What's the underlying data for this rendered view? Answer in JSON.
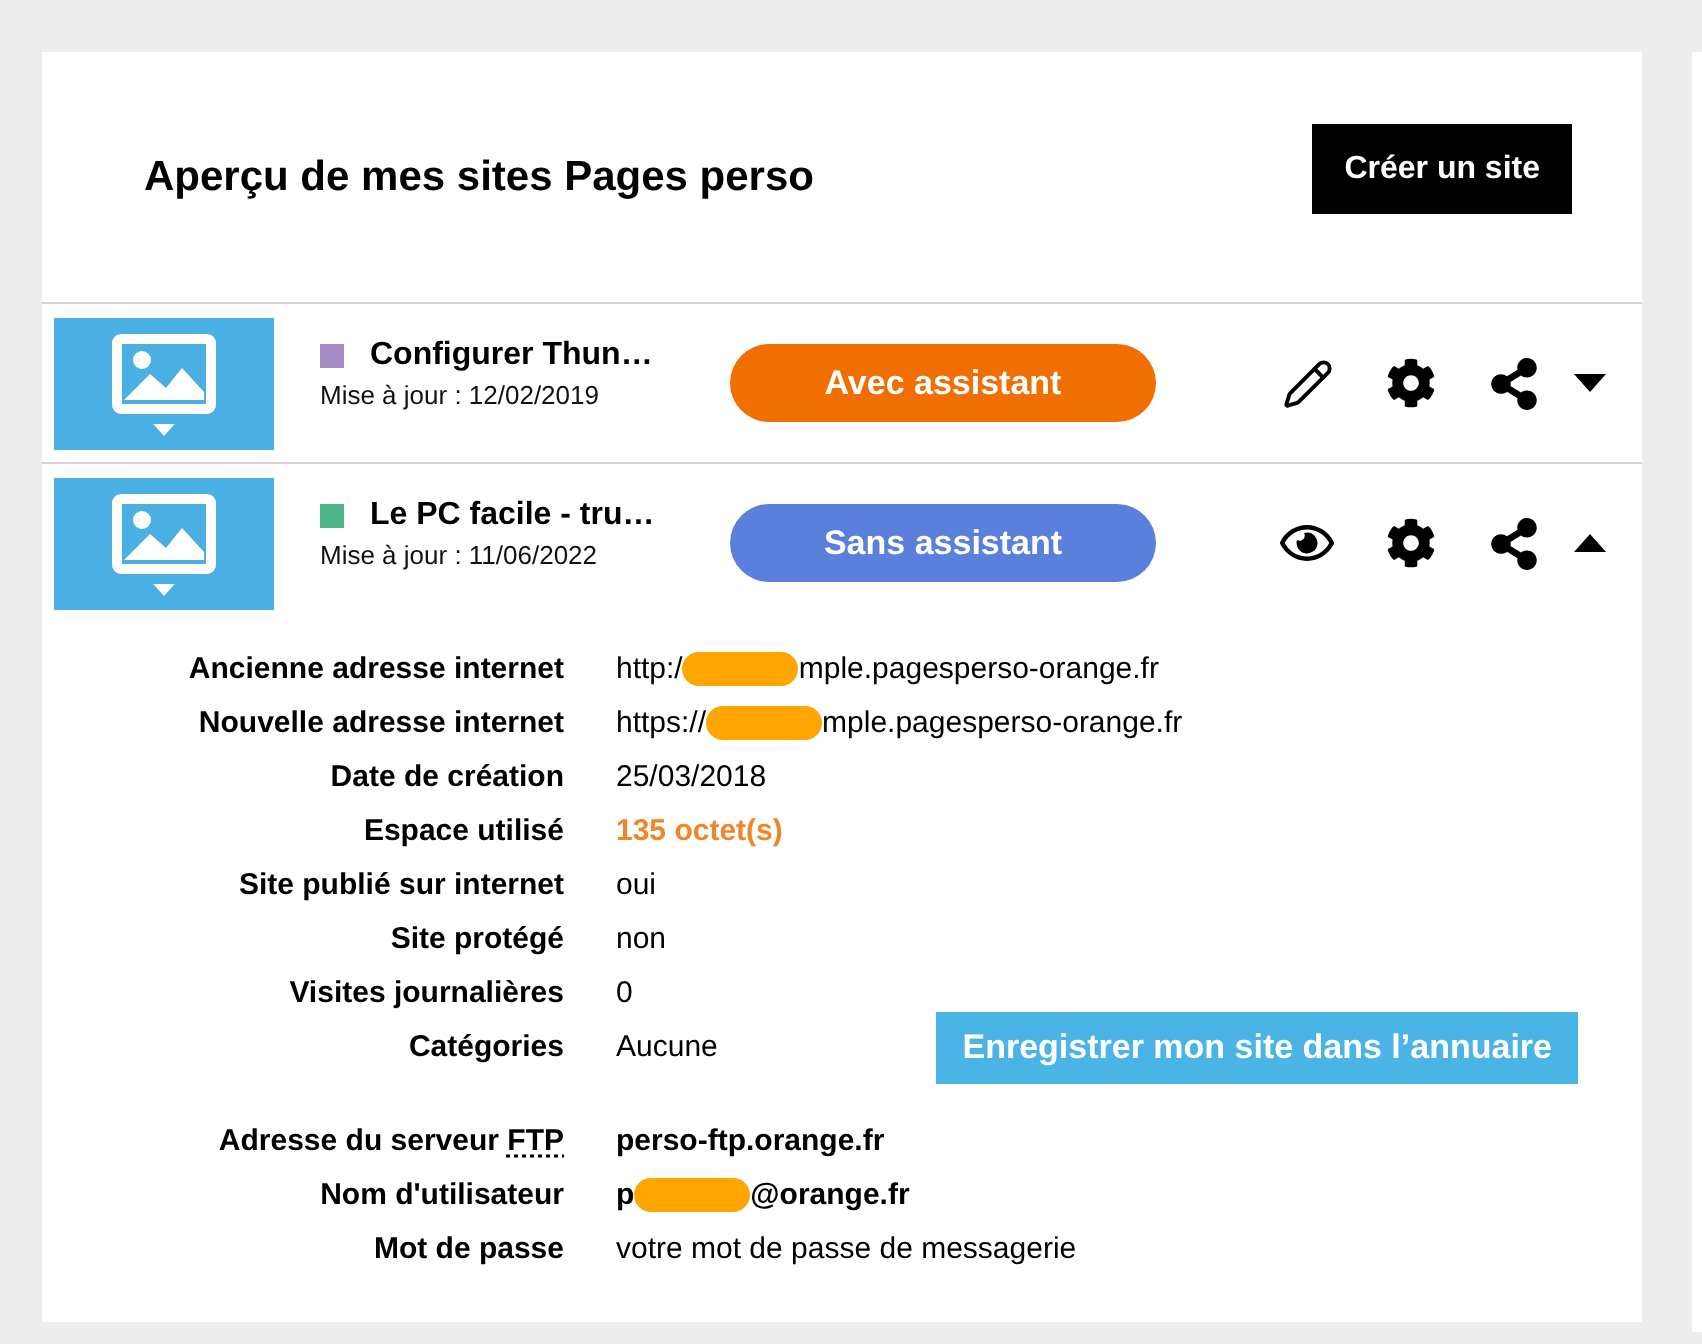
{
  "header": {
    "title": "Aperçu de mes sites Pages perso",
    "button": "Créer un site"
  },
  "sites": [
    {
      "kind": "edit",
      "color": "#a58bc6",
      "title": "Configurer Thun…",
      "updated": "Mise à jour : 12/02/2019",
      "mode": {
        "kind": "with",
        "label": "Avec assistant"
      },
      "expanded": false
    },
    {
      "kind": "view",
      "color": "#4fb48a",
      "title": "Le PC facile - tru…",
      "updated": "Mise à jour : 11/06/2022",
      "mode": {
        "kind": "without",
        "label": "Sans assistant"
      },
      "expanded": true,
      "details": [
        {
          "label": "Ancienne adresse internet",
          "kind": "redacted",
          "strong": false,
          "value_start": "http:/",
          "value_end": "mple.pagesperso-orange.fr"
        },
        {
          "label": "Nouvelle adresse internet",
          "kind": "redacted",
          "strong": false,
          "value_start": "https://",
          "value_end": "mple.pagesperso-orange.fr"
        },
        {
          "label": "Date de création",
          "kind": "plain",
          "strong": false,
          "value": "25/03/2018"
        },
        {
          "label": "Espace utilisé",
          "kind": "highlight",
          "strong": true,
          "value": "135 octet(s)"
        },
        {
          "label": "Site publié sur internet",
          "kind": "plain",
          "strong": false,
          "value": "oui"
        },
        {
          "label": "Site protégé",
          "kind": "plain",
          "strong": false,
          "value": "non"
        },
        {
          "label": "Visites journalières",
          "kind": "plain",
          "strong": false,
          "value": "0"
        },
        {
          "label": "Catégories",
          "kind": "plain",
          "strong": false,
          "value": "Aucune",
          "button": "Enregistrer mon site dans l’annuaire"
        }
      ],
      "ftp": [
        {
          "label": "Adresse du serveur",
          "abbr": "FTP",
          "kind": "plain",
          "strong": true,
          "value": "perso-ftp.orange.fr"
        },
        {
          "label": "Nom d'utilisateur",
          "kind": "redacted",
          "strong": true,
          "value_start": "p",
          "value_end": "@orange.fr"
        },
        {
          "label": "Mot de passe",
          "kind": "plain",
          "strong": false,
          "value": "votre mot de passe de messagerie"
        }
      ]
    }
  ]
}
